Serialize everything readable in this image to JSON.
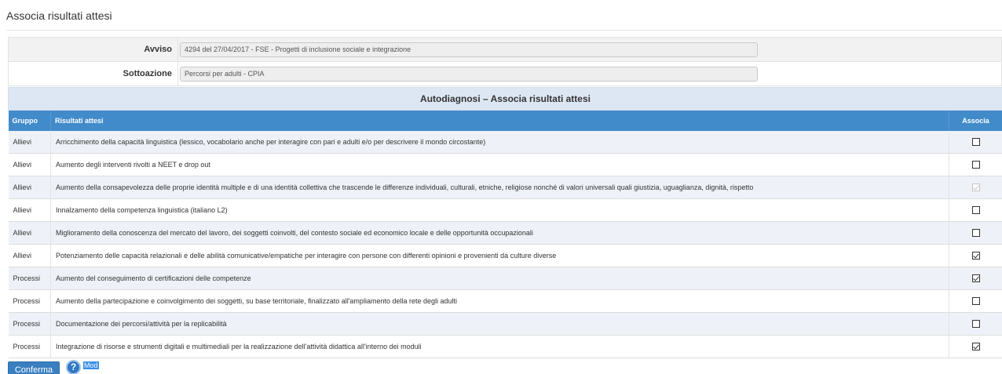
{
  "page": {
    "title": "Associa risultati attesi"
  },
  "meta": {
    "avviso": {
      "label": "Avviso",
      "value": "4294 del 27/04/2017 - FSE - Progetti di inclusione sociale e integrazione"
    },
    "sottoazione": {
      "label": "Sottoazione",
      "value": "Percorsi per adulti - CPIA"
    }
  },
  "table": {
    "section_title": "Autodiagnosi – Associa risultati attesi",
    "headers": {
      "gruppo": "Gruppo",
      "risultati": "Risultati attesi",
      "associa": "Associa"
    },
    "rows": [
      {
        "gruppo": "Allievi",
        "risultato": "Arricchimento della capacità linguistica (lessico, vocabolario anche per interagire con pari e adulti e/o per descrivere il mondo circostante)",
        "checked": false,
        "disabled": false
      },
      {
        "gruppo": "Allievi",
        "risultato": "Aumento degli interventi rivolti a NEET e drop out",
        "checked": false,
        "disabled": false
      },
      {
        "gruppo": "Allievi",
        "risultato": "Aumento della consapevolezza delle proprie identità multiple e di una identità collettiva che trascende le differenze individuali, culturali, etniche, religiose nonché di valori universali quali giustizia, uguaglianza, dignità, rispetto",
        "checked": true,
        "disabled": true
      },
      {
        "gruppo": "Allievi",
        "risultato": "Innalzamento della competenza linguistica (italiano L2)",
        "checked": false,
        "disabled": false
      },
      {
        "gruppo": "Allievi",
        "risultato": "Miglioramento della conoscenza del mercato del lavoro, dei soggetti coinvolti, del contesto sociale ed economico locale e delle opportunità occupazionali",
        "checked": false,
        "disabled": false
      },
      {
        "gruppo": "Allievi",
        "risultato": "Potenziamento delle capacità relazionali e delle abilità comunicative/empatiche per interagire con persone con differenti opinioni e provenienti da culture diverse",
        "checked": true,
        "disabled": false
      },
      {
        "gruppo": "Processi",
        "risultato": "Aumento del conseguimento di certificazioni delle competenze",
        "checked": true,
        "disabled": false
      },
      {
        "gruppo": "Processi",
        "risultato": "Aumento della partecipazione e coinvolgimento dei soggetti, su base territoriale, finalizzato all'ampliamento della rete degli adulti",
        "checked": false,
        "disabled": false
      },
      {
        "gruppo": "Processi",
        "risultato": "Documentazione dei percorsi/attività per la replicabilità",
        "checked": false,
        "disabled": false
      },
      {
        "gruppo": "Processi",
        "risultato": "Integrazione di risorse e strumenti digitali e multimediali per la realizzazione dell'attività didattica all'interno dei moduli",
        "checked": true,
        "disabled": false
      }
    ]
  },
  "actions": {
    "confirm_label": "Conferma",
    "help_icon": "question-circle-icon",
    "help_link_label": "Mod"
  },
  "colors": {
    "header_blue": "#428bca",
    "section_title_bg": "#dde7f3",
    "odd_row_bg": "#eef2f8",
    "button_blue": "#3a7fc0"
  }
}
